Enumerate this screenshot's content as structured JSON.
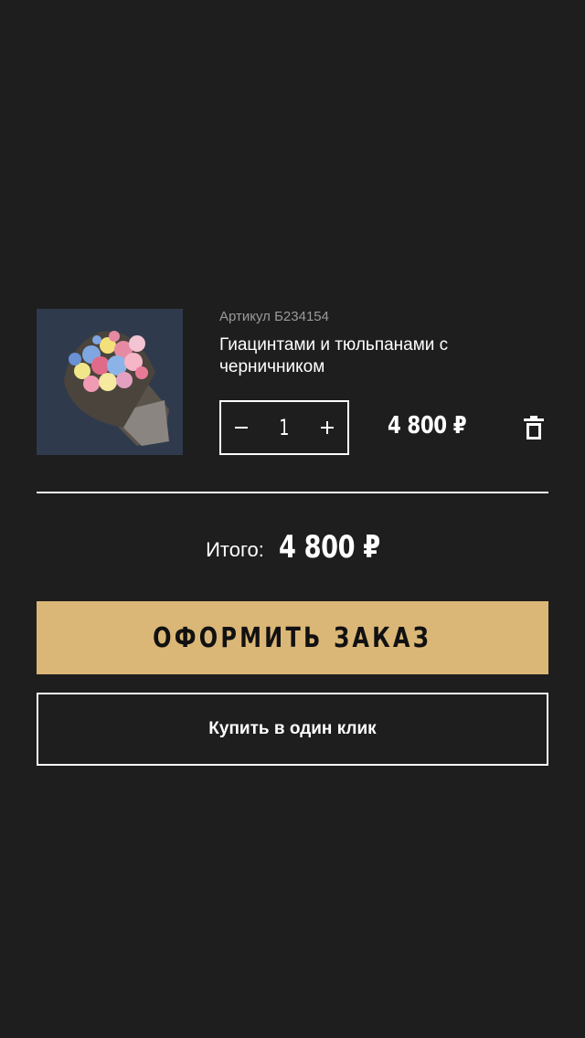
{
  "cart": {
    "items": [
      {
        "article": "Артикул Б234154",
        "name": "Гиацинтами и тюльпанами с черничником",
        "quantity": "1",
        "price": "4 800 ₽",
        "image_icon": "flower-bouquet-image"
      }
    ]
  },
  "summary": {
    "total_label": "Итого:",
    "total_value": "4 800 ₽"
  },
  "actions": {
    "checkout_label": "ОФОРМИТЬ ЗАКАЗ",
    "one_click_label": "Купить в один клик"
  },
  "colors": {
    "background": "#1e1e1e",
    "accent": "#dbb777",
    "text": "#ffffff",
    "muted_text": "#9a9a9a"
  },
  "icons": {
    "decrement": "minus-icon",
    "increment": "plus-icon",
    "delete": "trash-icon"
  }
}
